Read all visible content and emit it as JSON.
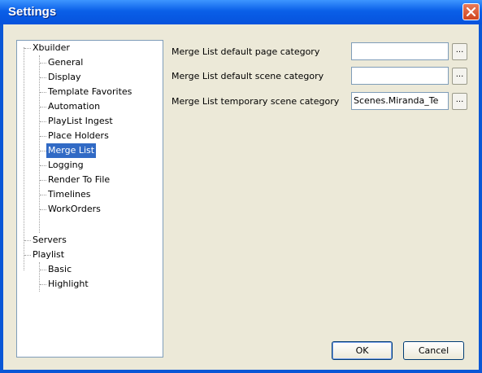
{
  "window": {
    "title": "Settings"
  },
  "tree": {
    "roots": [
      {
        "label": "Xbuilder",
        "children": [
          "General",
          "Display",
          "Template Favorites",
          "Automation",
          "PlayList Ingest",
          "Place Holders",
          "Merge List",
          "Logging",
          "Render To File",
          "Timelines",
          "WorkOrders"
        ]
      },
      {
        "label": "Servers",
        "children": []
      },
      {
        "label": "Playlist",
        "children": [
          "Basic",
          "Highlight"
        ]
      }
    ],
    "selected": "Merge List"
  },
  "form": {
    "rows": [
      {
        "label": "Merge List default page category",
        "value": "",
        "browse": "..."
      },
      {
        "label": "Merge List default scene category",
        "value": "",
        "browse": "..."
      },
      {
        "label": "Merge List temporary scene category",
        "value": "Scenes.Miranda_Te",
        "browse": "..."
      }
    ]
  },
  "buttons": {
    "ok": "OK",
    "cancel": "Cancel"
  },
  "colors": {
    "title_bar": "#0a5fe8",
    "selection": "#316ac5",
    "dialog_bg": "#ece9d8"
  }
}
